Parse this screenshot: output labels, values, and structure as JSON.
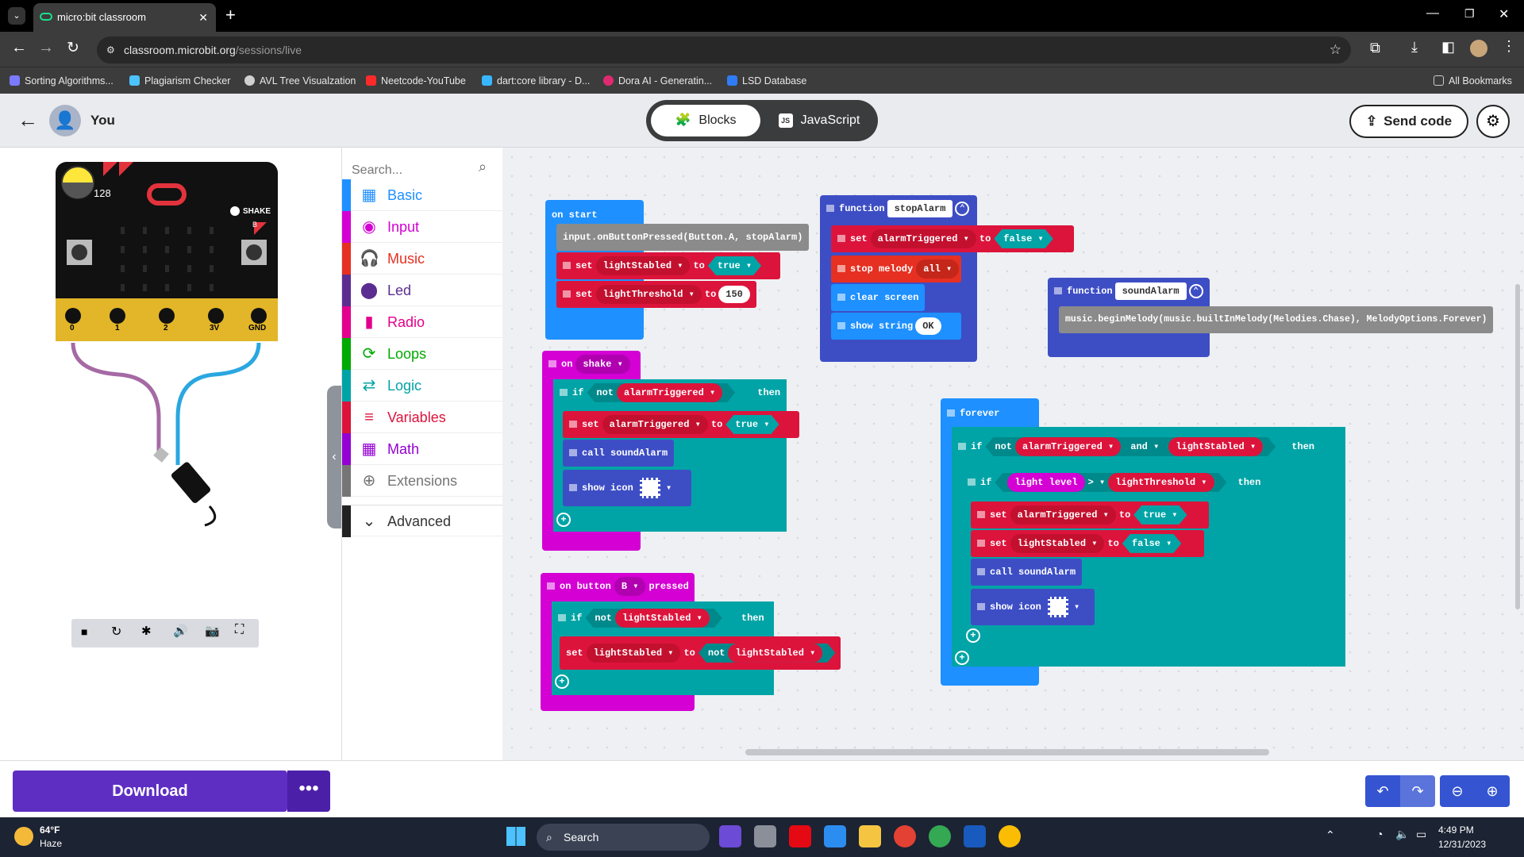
{
  "browser": {
    "tab_title": "micro:bit classroom",
    "url_host": "classroom.microbit.org",
    "url_path": "/sessions/live"
  },
  "bookmarks": [
    {
      "label": "Sorting Algorithms...",
      "color": "#7a7aff"
    },
    {
      "label": "Plagiarism Checker",
      "color": "#4cc3ff"
    },
    {
      "label": "AVL Tree Visualzation",
      "color": "#d0d0d0"
    },
    {
      "label": "Neetcode-YouTube",
      "color": "#ff2a2a"
    },
    {
      "label": "dart:core library - D...",
      "color": "#38b6ff"
    },
    {
      "label": "Dora AI - Generatin...",
      "color": "#e02a6f"
    },
    {
      "label": "LSD Database",
      "color": "#2f7cf6"
    }
  ],
  "all_bookmarks": "All Bookmarks",
  "header": {
    "user": "You",
    "blocks": "Blocks",
    "javascript": "JavaScript",
    "send": "Send code",
    "js_badge": "JS"
  },
  "sim": {
    "light_value": "128",
    "shake": "SHAKE",
    "pins": [
      "0",
      "1",
      "2",
      "3V",
      "GND"
    ],
    "button_b": "B"
  },
  "toolbox": {
    "search_placeholder": "Search...",
    "categories": [
      {
        "label": "Basic",
        "color": "#1e90ff",
        "glyph": "▦"
      },
      {
        "label": "Input",
        "color": "#d400d4",
        "glyph": "◉"
      },
      {
        "label": "Music",
        "color": "#e63022",
        "glyph": "🎧"
      },
      {
        "label": "Led",
        "color": "#5c2d91",
        "glyph": "⬤"
      },
      {
        "label": "Radio",
        "color": "#e3008c",
        "glyph": "▮"
      },
      {
        "label": "Loops",
        "color": "#00aa00",
        "glyph": "⟳"
      },
      {
        "label": "Logic",
        "color": "#00a4a6",
        "glyph": "⇄"
      },
      {
        "label": "Variables",
        "color": "#dc143c",
        "glyph": "≡"
      },
      {
        "label": "Math",
        "color": "#9400d3",
        "glyph": "▦"
      },
      {
        "label": "Extensions",
        "color": "#757575",
        "glyph": "⊕"
      }
    ],
    "advanced": "Advanced"
  },
  "blocks": {
    "on_start": {
      "hat": "on start",
      "l1": "input.onButtonPressed(Button.A, stopAlarm)",
      "set": "set",
      "var1": "lightStabled",
      "to": "to",
      "true": "true",
      "var2": "lightThreshold",
      "num": "150"
    },
    "on_shake": {
      "hat": "on",
      "event": "shake",
      "if": "if",
      "not": "not",
      "var": "alarmTriggered",
      "then": "then",
      "set": "set",
      "to": "to",
      "true": "true",
      "call": "call soundAlarm",
      "show_icon": "show icon"
    },
    "on_button": {
      "hat1": "on button",
      "btn": "B",
      "hat2": "pressed",
      "if": "if",
      "not": "not",
      "var": "lightStabled",
      "then": "then",
      "set": "set",
      "to": "to"
    },
    "stop_fn": {
      "fn": "function",
      "name": "stopAlarm",
      "set": "set",
      "var": "alarmTriggered",
      "to": "to",
      "false": "false",
      "stop": "stop melody",
      "all": "all",
      "clear": "clear screen",
      "show": "show string",
      "ok": "OK"
    },
    "sound_fn": {
      "fn": "function",
      "name": "soundAlarm",
      "code": "music.beginMelody(music.builtInMelody(Melodies.Chase), MelodyOptions.Forever)"
    },
    "forever": {
      "hat": "forever",
      "if": "if",
      "not": "not",
      "var1": "alarmTriggered",
      "and": "and",
      "var2": "lightStabled",
      "then": "then",
      "light": "light level",
      "op": ">",
      "thr": "lightThreshold",
      "set": "set",
      "to": "to",
      "true": "true",
      "false": "false",
      "call": "call soundAlarm",
      "show_icon": "show icon"
    }
  },
  "bottom": {
    "download": "Download",
    "more": "•••"
  },
  "taskbar": {
    "temp": "64°F",
    "weather": "Haze",
    "search": "Search",
    "time": "4:49 PM",
    "date": "12/31/2023"
  }
}
